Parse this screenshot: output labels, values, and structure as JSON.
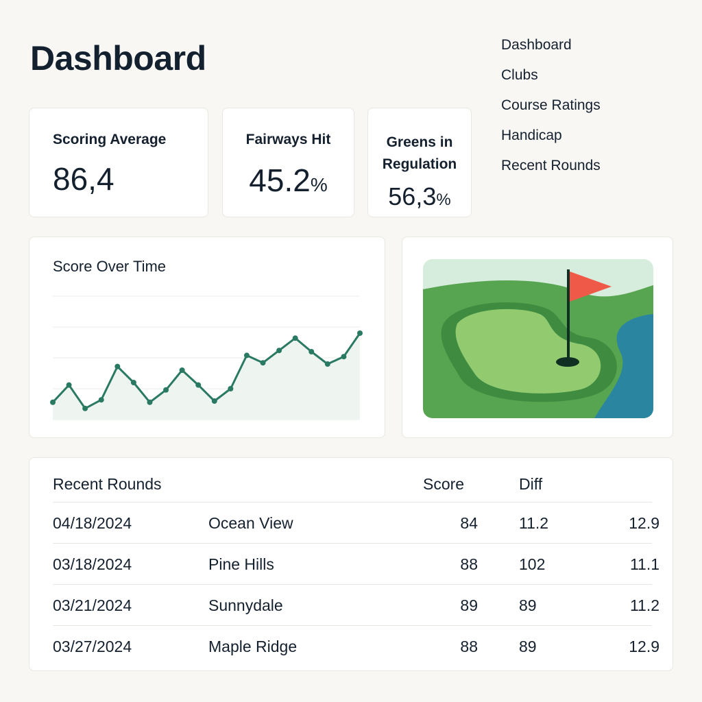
{
  "header": {
    "title": "Dashboard"
  },
  "nav": {
    "items": [
      {
        "label": "Dashboard"
      },
      {
        "label": "Clubs"
      },
      {
        "label": "Course Ratings"
      },
      {
        "label": "Handicap"
      },
      {
        "label": "Recent Rounds"
      }
    ]
  },
  "stats": {
    "scoring": {
      "label": "Scoring Average",
      "value": "86,4"
    },
    "fairways": {
      "label": "Fairways Hit",
      "value": "45.2",
      "unit": "%"
    },
    "gir": {
      "label_line1": "Greens in",
      "label_line2": "Regulation",
      "value": "56,3",
      "unit": "%"
    }
  },
  "chart": {
    "title": "Score Over Time"
  },
  "chart_data": {
    "type": "area",
    "title": "Score Over Time",
    "xlabel": "",
    "ylabel": "",
    "grid": true,
    "legend": "none",
    "x": [
      1,
      2,
      3,
      4,
      5,
      6,
      7,
      8,
      9,
      10,
      11,
      12,
      13,
      14,
      15,
      16,
      17,
      18,
      19,
      20
    ],
    "values": [
      14,
      28,
      9,
      16,
      43,
      30,
      14,
      24,
      40,
      28,
      15,
      25,
      52,
      46,
      56,
      66,
      55,
      45,
      51,
      70
    ],
    "ylim": [
      0,
      100
    ],
    "colors": {
      "line": "#2a7a63",
      "fill": "#eef4f0"
    }
  },
  "illustration": {
    "name": "golf-green-flag",
    "colors": {
      "sky": "#d6ecdc",
      "fairway": "#58a551",
      "green": "#92cb6f",
      "water": "#2a85a0",
      "flag": "#ef5a48"
    }
  },
  "rounds": {
    "headers": {
      "title": "Recent Rounds",
      "score": "Score",
      "diff": "Diff"
    },
    "rows": [
      {
        "date": "04/18/2024",
        "course": "Ocean View",
        "score": "84",
        "diff": "11.2",
        "hcp": "12.9"
      },
      {
        "date": "03/18/2024",
        "course": "Pine Hills",
        "score": "88",
        "diff": "102",
        "hcp": "11.1"
      },
      {
        "date": "03/21/2024",
        "course": "Sunnydale",
        "score": "89",
        "diff": "89",
        "hcp": "11.2"
      },
      {
        "date": "03/27/2024",
        "course": "Maple Ridge",
        "score": "88",
        "diff": "89",
        "hcp": "12.9"
      }
    ]
  }
}
